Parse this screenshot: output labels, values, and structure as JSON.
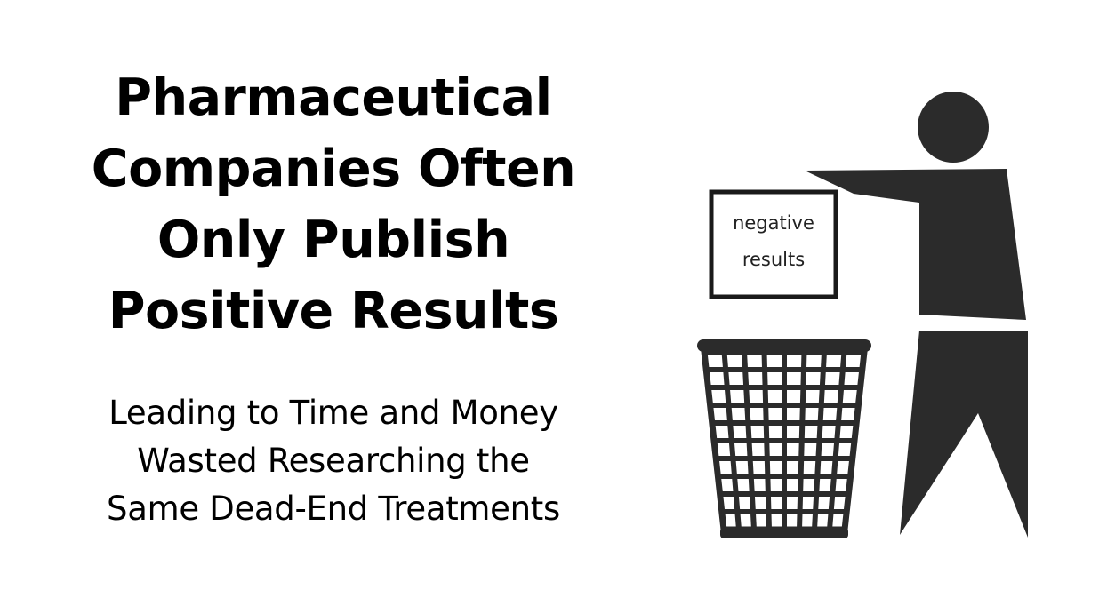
{
  "headline": {
    "lines": [
      "Pharmaceutical",
      "Companies Often",
      "Only Publish",
      "Positive Results"
    ]
  },
  "subheadline": {
    "lines": [
      "Leading to Time and Money",
      "Wasted Researching the",
      "Same Dead-End Treatments"
    ]
  },
  "illustration": {
    "paper_label": {
      "line1": "negative",
      "line2": "results"
    },
    "figure_color": "#2b2b2b",
    "paper_border_color": "#1a1a1a"
  }
}
